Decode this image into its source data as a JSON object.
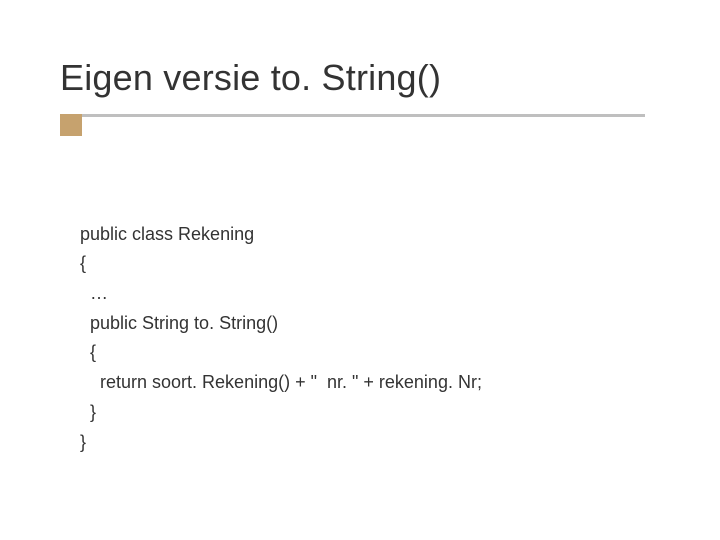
{
  "title": "Eigen versie to. String()",
  "code": {
    "l1": "public class Rekening",
    "l2": "{",
    "l3": "  …",
    "l4": "  public String to. String()",
    "l5": "  {",
    "l6": "    return soort. Rekening() + \"  nr. \" + rekening. Nr;",
    "l7": "  }",
    "l8": "}"
  }
}
